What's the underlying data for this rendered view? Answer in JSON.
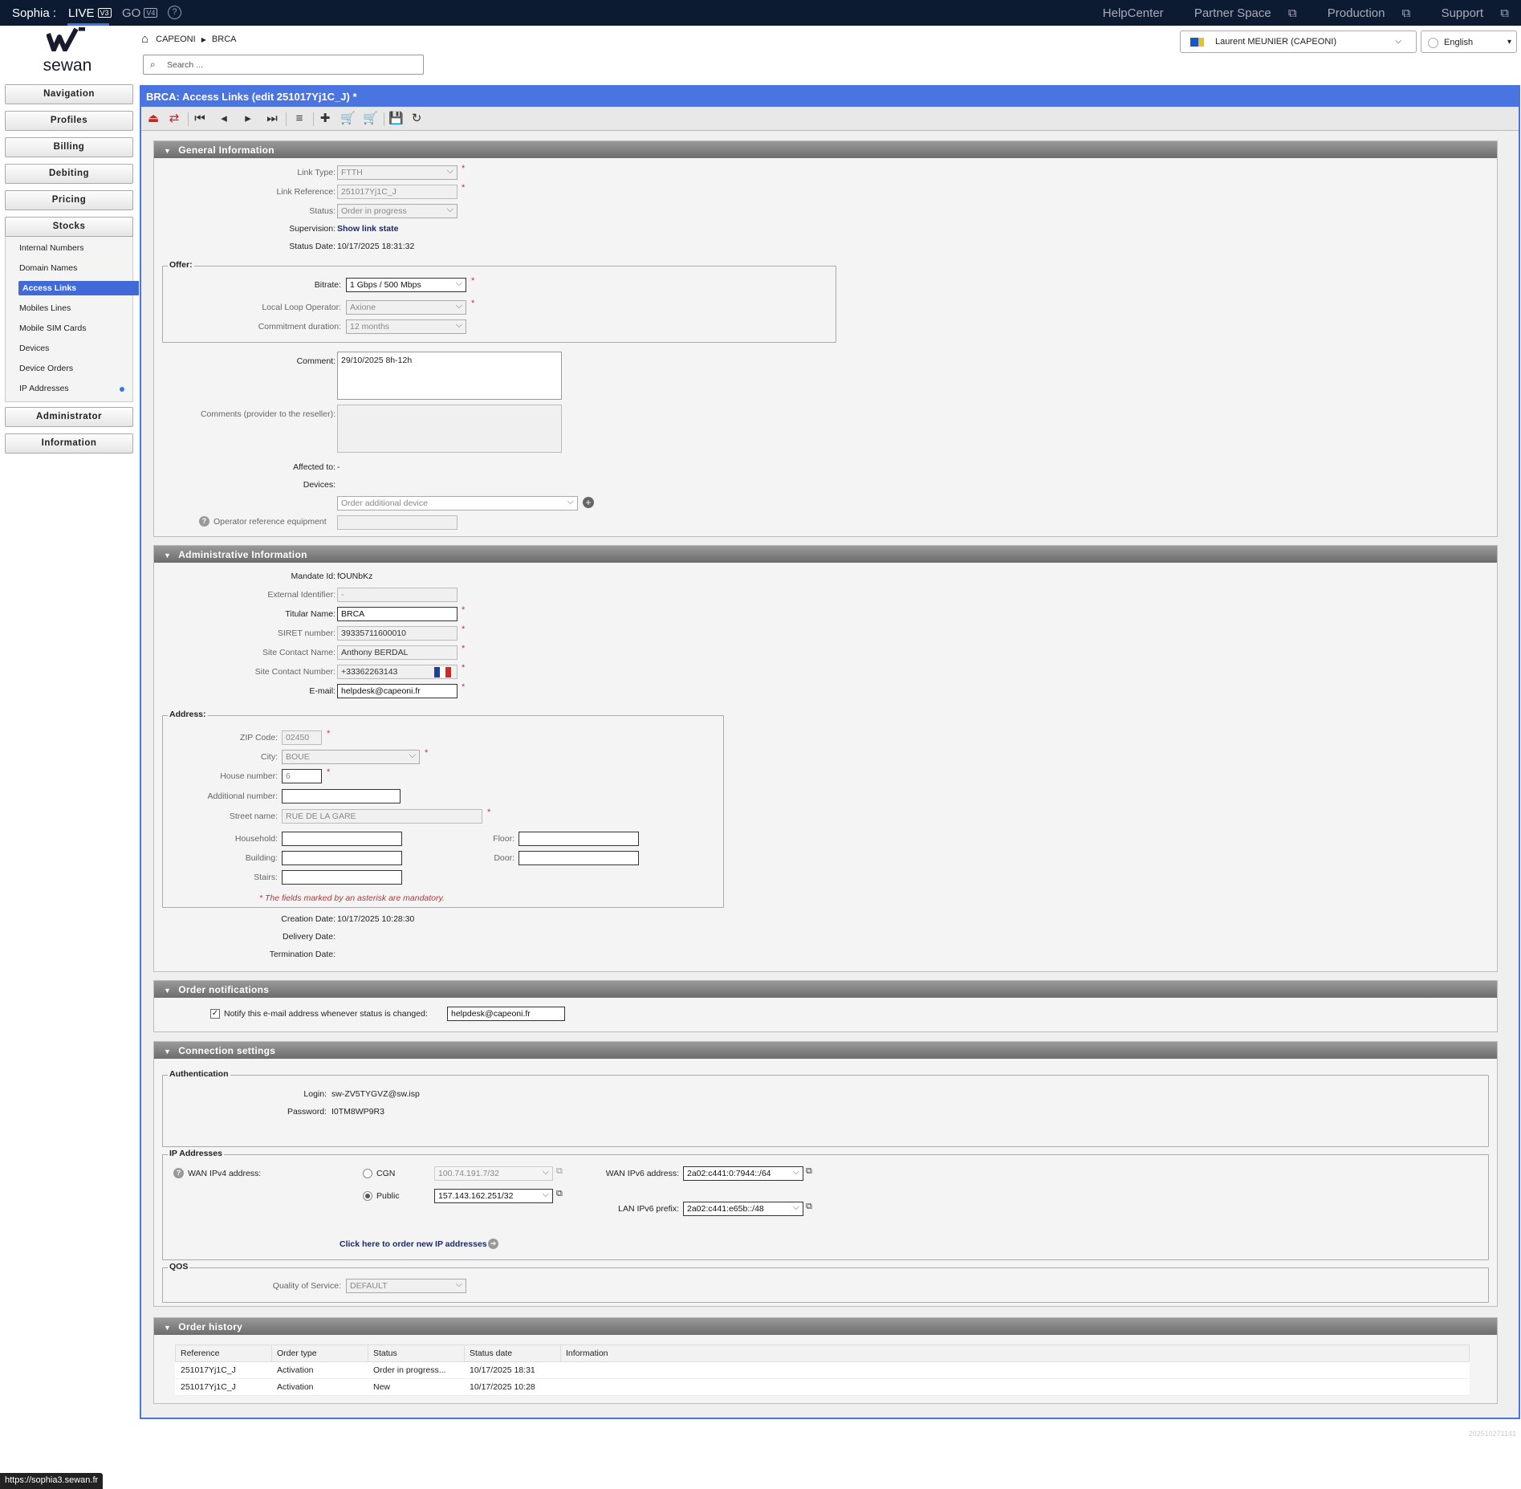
{
  "topbar": {
    "brand": "Sophia :",
    "live_label": "LIVE",
    "live_version": "V3",
    "go_label": "GO",
    "go_version": "V4",
    "help_icon": "?",
    "links": [
      "HelpCenter",
      "Partner Space",
      "Production",
      "Support"
    ]
  },
  "logo": {
    "wordmark": "sewan"
  },
  "sidebar": {
    "sections": [
      "Navigation",
      "Profiles",
      "Billing",
      "Debiting",
      "Pricing",
      "Stocks"
    ],
    "stocks_items": [
      "Internal Numbers",
      "Domain Names",
      "Access Links",
      "Mobiles Lines",
      "Mobile SIM Cards",
      "Devices",
      "Device Orders",
      "IP Addresses"
    ],
    "active_item": "Access Links",
    "bottom_sections": [
      "Administrator",
      "Information"
    ]
  },
  "breadcrumb": {
    "items": [
      "CAPEONI",
      "BRCA"
    ]
  },
  "search": {
    "placeholder": "Search ..."
  },
  "user": {
    "name": "Laurent MEUNIER (CAPEONI)"
  },
  "language": {
    "selected": "English"
  },
  "window": {
    "title": "BRCA: Access Links (edit 251017Yj1C_J) *"
  },
  "general": {
    "header": "General Information",
    "link_type_label": "Link Type:",
    "link_type": "FTTH",
    "link_ref_label": "Link Reference:",
    "link_ref": "251017Yj1C_J",
    "status_label": "Status:",
    "status": "Order in progress",
    "supervision_label": "Supervision:",
    "supervision_link": "Show link state",
    "status_date_label": "Status Date:",
    "status_date": "10/17/2025 18:31:32",
    "offer_legend": "Offer:",
    "bitrate_label": "Bitrate:",
    "bitrate": "1 Gbps / 500 Mbps",
    "llo_label": "Local Loop Operator:",
    "llo": "Axione",
    "commit_label": "Commitment duration:",
    "commit": "12 months",
    "comment_label": "Comment:",
    "comment": "29/10/2025 8h-12h",
    "comments_provider_label": "Comments (provider to the reseller):",
    "affected_label": "Affected to:",
    "affected": "-",
    "devices_label": "Devices:",
    "order_device_placeholder": "Order additional device",
    "operator_ref_label": "Operator reference equipment"
  },
  "admin": {
    "header": "Administrative Information",
    "mandate_label": "Mandate Id:",
    "mandate": "fOUNbKz",
    "ext_id_label": "External Identifier:",
    "ext_id": "-",
    "titular_label": "Titular Name:",
    "titular": "BRCA",
    "siret_label": "SIRET number:",
    "siret": "39335711600010",
    "contact_name_label": "Site Contact Name:",
    "contact_name": "Anthony BERDAL",
    "contact_number_label": "Site Contact Number:",
    "contact_number": "+33362263143",
    "email_label": "E-mail:",
    "email": "helpdesk@capeoni.fr",
    "address_legend": "Address:",
    "zip_label": "ZIP Code:",
    "zip": "02450",
    "city_label": "City:",
    "city": "BOUE",
    "house_label": "House number:",
    "house": "6",
    "additional_label": "Additional number:",
    "street_label": "Street name:",
    "street": "RUE DE LA GARE",
    "household_label": "Household:",
    "floor_label": "Floor:",
    "building_label": "Building:",
    "door_label": "Door:",
    "stairs_label": "Stairs:",
    "mandatory_note": "* The fields marked by an asterisk are mandatory.",
    "creation_label": "Creation Date:",
    "creation": "10/17/2025 10:28:30",
    "delivery_label": "Delivery Date:",
    "termination_label": "Termination Date:"
  },
  "notifications": {
    "header": "Order notifications",
    "notify_label": "Notify this e-mail address whenever status is changed:",
    "notify_email": "helpdesk@capeoni.fr"
  },
  "connection": {
    "header": "Connection settings",
    "auth_legend": "Authentication",
    "login_label": "Login:",
    "login": "sw-ZV5TYGVZ@sw.isp",
    "password_label": "Password:",
    "password": "I0TM8WP9R3",
    "ip_legend": "IP Addresses",
    "wan_ipv4_label": "WAN IPv4 address:",
    "cgn_label": "CGN",
    "cgn_value": "100.74.191.7/32",
    "public_label": "Public",
    "public_value": "157.143.162.251/32",
    "wan_ipv6_label": "WAN IPv6 address:",
    "wan_ipv6": "2a02:c441:0:7944::/64",
    "lan_ipv6_label": "LAN IPv6 prefix:",
    "lan_ipv6": "2a02:c441:e65b::/48",
    "order_ip_link": "Click here to order new IP addresses",
    "qos_legend": "QOS",
    "qos_label": "Quality of Service:",
    "qos": "DEFAULT"
  },
  "history": {
    "header": "Order history",
    "columns": [
      "Reference",
      "Order type",
      "Status",
      "Status date",
      "Information"
    ],
    "rows": [
      [
        "251017Yj1C_J",
        "Activation",
        "Order in progress...",
        "10/17/2025 18:31",
        ""
      ],
      [
        "251017Yj1C_J",
        "Activation",
        "New",
        "10/17/2025 10:28",
        ""
      ]
    ]
  },
  "status_url": "https://sophia3.sewan.fr",
  "build_number": "202510271141"
}
